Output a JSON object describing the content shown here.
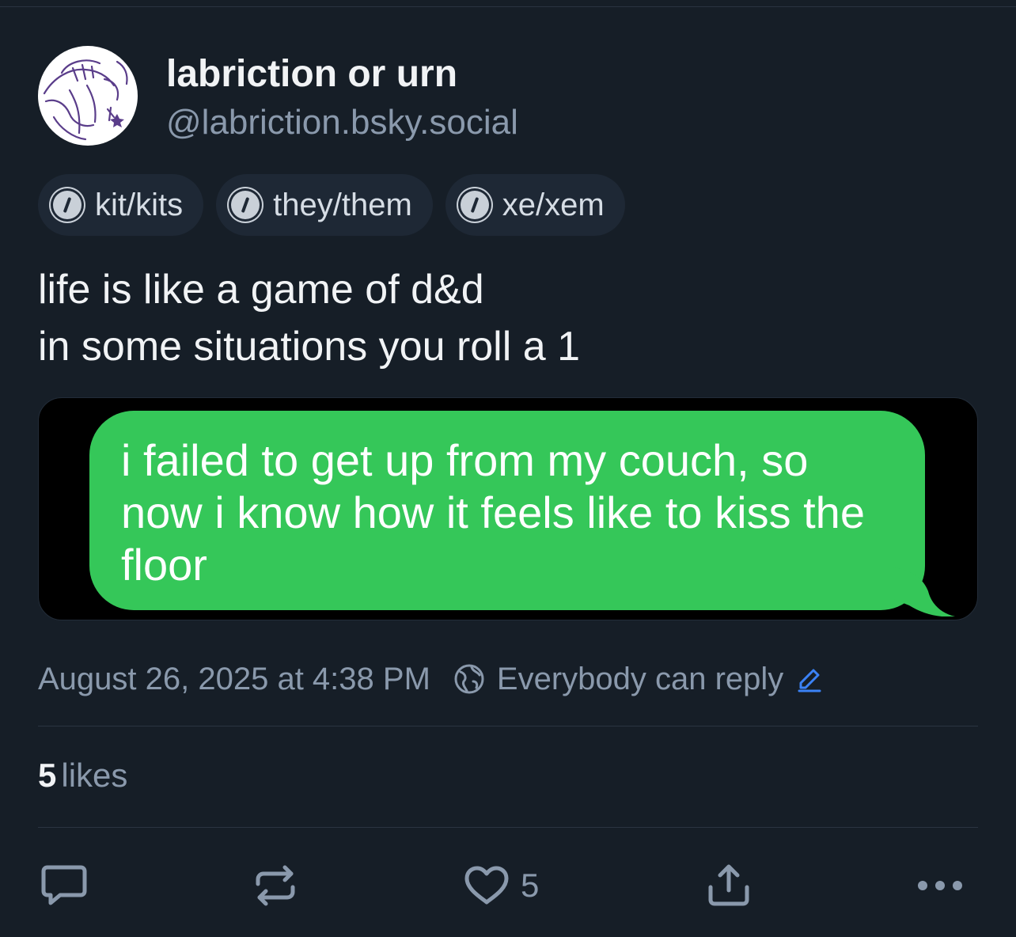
{
  "author": {
    "display_name": "labriction or urn",
    "handle": "@labriction.bsky.social",
    "avatar_icon": "avatar-sketch-icon"
  },
  "pronouns": [
    "kit/kits",
    "they/them",
    "xe/xem"
  ],
  "post": {
    "lines": [
      "life is like a game of d&d",
      "in some situations you roll a 1"
    ]
  },
  "embed": {
    "bubble_lines": [
      "i failed to get up from my couch, so",
      "now i know how it feels like to kiss the",
      "floor"
    ],
    "bubble_color": "#35c759"
  },
  "meta": {
    "timestamp": "August 26, 2025 at 4:38 PM",
    "reply_setting": "Everybody can reply"
  },
  "stats": {
    "likes_count": "5",
    "likes_label": "likes"
  },
  "actions": {
    "like_count": "5",
    "icons": [
      "reply-icon",
      "repost-icon",
      "heart-icon",
      "share-icon",
      "more-icon"
    ]
  },
  "colors": {
    "background": "#161e27",
    "muted_text": "#8a99ac",
    "accent": "#3b82f6"
  }
}
